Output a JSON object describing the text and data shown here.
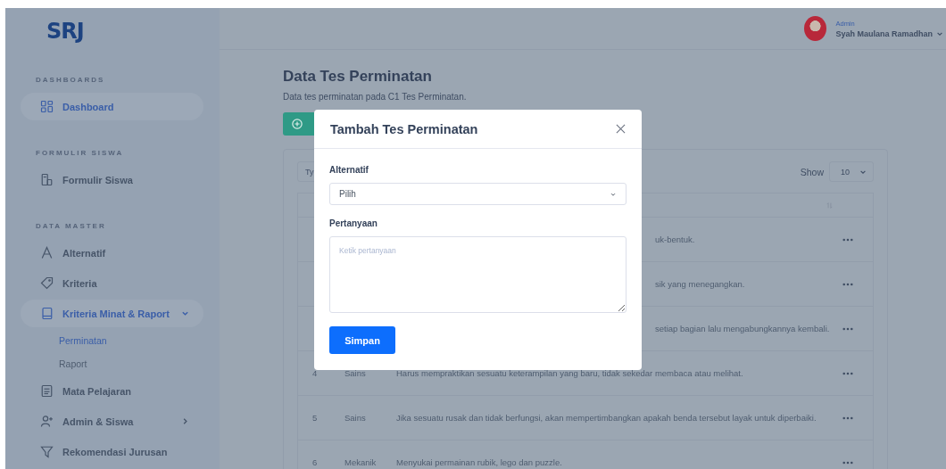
{
  "logo": "SRJ",
  "sidebar": {
    "sections": [
      {
        "title": "DASHBOARDS",
        "items": [
          {
            "label": "Dashboard",
            "kind": "grid",
            "selected": true
          }
        ]
      },
      {
        "title": "FORMULIR SISWA",
        "items": [
          {
            "label": "Formulir Siswa",
            "kind": "form",
            "selected": false
          }
        ]
      },
      {
        "title": "DATA MASTER",
        "items": [
          {
            "label": "Alternatif",
            "kind": "letter",
            "selected": false
          },
          {
            "label": "Kriteria",
            "kind": "tag",
            "selected": false
          },
          {
            "label": "Kriteria Minat & Raport",
            "kind": "book",
            "selected": true,
            "expanded": true,
            "children": [
              {
                "label": "Perminatan",
                "selected": true
              },
              {
                "label": "Raport",
                "selected": false
              }
            ]
          },
          {
            "label": "Mata Pelajaran",
            "kind": "list",
            "selected": false
          },
          {
            "label": "Admin & Siswa",
            "kind": "user",
            "selected": false,
            "expanded": false
          },
          {
            "label": "Rekomendasi Jurusan",
            "kind": "filter",
            "selected": false
          }
        ]
      }
    ]
  },
  "user": {
    "role": "Admin",
    "name": "Syah Maulana Ramadhan"
  },
  "page": {
    "title": "Data Tes Perminatan",
    "subtitle": "Data tes perminatan pada C1 Tes Perminatan."
  },
  "table": {
    "search_placeholder": "Ty",
    "show_label": "Show",
    "page_size": "10",
    "rows": [
      {
        "pertanyaan": "uk-bentuk."
      },
      {
        "pertanyaan": "sik yang menegangkan."
      },
      {
        "pertanyaan": "setiap bagian lalu mengabungkannya kembali."
      },
      {
        "no": "4",
        "alternatif": "Sains",
        "pertanyaan": "Harus mempraktikan sesuatu keterampilan yang baru, tidak sekedar membaca atau melihat."
      },
      {
        "no": "5",
        "alternatif": "Sains",
        "pertanyaan": "Jika sesuatu rusak dan tidak berfungsi, akan mempertimbangkan apakah benda tersebut layak untuk diperbaiki."
      },
      {
        "no": "6",
        "alternatif": "Mekanik",
        "pertanyaan": "Menyukai permainan rubik, lego dan puzzle."
      }
    ]
  },
  "modal": {
    "title": "Tambah Tes Perminatan",
    "fields": [
      {
        "kind": "select",
        "label": "Alternatif",
        "value": "Pilih"
      },
      {
        "kind": "textarea",
        "label": "Pertanyaan",
        "placeholder": "Ketik pertanyaan"
      }
    ],
    "submit": "Simpan"
  }
}
